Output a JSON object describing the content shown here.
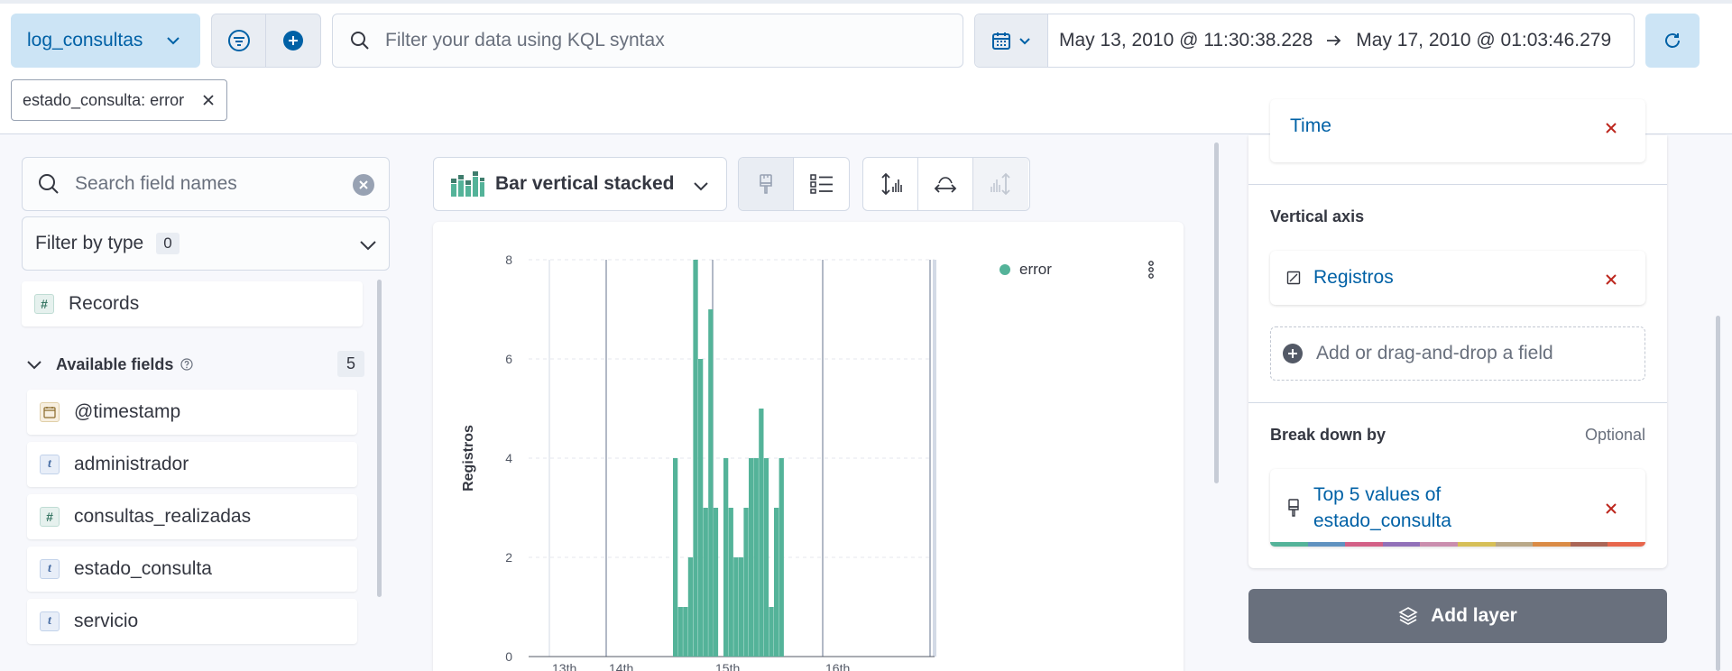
{
  "topbar": {
    "data_view": "log_consultas",
    "query_placeholder": "Filter your data using KQL syntax",
    "date_start": "May 13, 2010 @ 11:30:38.228",
    "date_end": "May 17, 2010 @ 01:03:46.279",
    "filter_pill": "estado_consulta: error"
  },
  "sidebar": {
    "search_placeholder": "Search field names",
    "filter_by_type_label": "Filter by type",
    "filter_by_type_count": "0",
    "records_label": "Records",
    "available_fields_label": "Available fields",
    "available_fields_count": "5",
    "fields": [
      {
        "name": "@timestamp",
        "type": "date"
      },
      {
        "name": "administrador",
        "type": "string"
      },
      {
        "name": "consultas_realizadas",
        "type": "number"
      },
      {
        "name": "estado_consulta",
        "type": "string"
      },
      {
        "name": "servicio",
        "type": "string"
      }
    ]
  },
  "workspace": {
    "visualization_type": "Bar vertical stacked"
  },
  "config": {
    "horizontal_field": "Time",
    "vertical_axis_label": "Vertical axis",
    "vertical_field": "Registros",
    "add_field_label": "Add or drag-and-drop a field",
    "break_down_label": "Break down by",
    "break_down_optional": "Optional",
    "break_down_field_line1": "Top 5 values of",
    "break_down_field_line2": "estado_consulta",
    "add_layer_label": "Add layer",
    "palette": [
      "#54b399",
      "#6092c0",
      "#d36086",
      "#9170b8",
      "#ca8eae",
      "#d6bf57",
      "#b9a888",
      "#da8b45",
      "#aa6556",
      "#e7664c"
    ]
  },
  "colors": {
    "primary": "#0061a6",
    "series_error": "#54b399",
    "danger": "#bd271e"
  },
  "chart_data": {
    "type": "bar",
    "stacked": true,
    "ylabel": "Registros",
    "ylim": [
      0,
      8
    ],
    "yticks": [
      0,
      2,
      4,
      6,
      8
    ],
    "x_tick_labels": [
      "13th",
      "14th",
      "15th",
      "16th"
    ],
    "legend_position": "top-right",
    "series": [
      {
        "name": "error",
        "color": "#54b399",
        "values": [
          4,
          1,
          1,
          2,
          8,
          6,
          3,
          7,
          3,
          0,
          4,
          3,
          2,
          2,
          3,
          4,
          4,
          5,
          4,
          1,
          3,
          4
        ]
      }
    ],
    "grid": true
  }
}
